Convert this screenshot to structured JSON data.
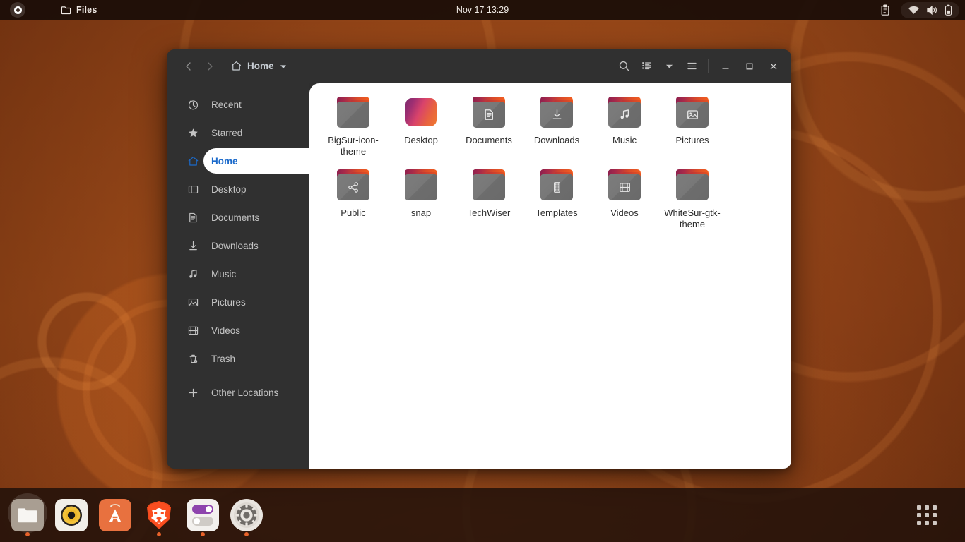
{
  "topbar": {
    "activities_icon": "activities-circle-icon",
    "app_menu": {
      "icon": "folder-icon",
      "label": "Files"
    },
    "clock": "Nov 17  13:29",
    "indicators": [
      {
        "name": "clipboard-icon"
      },
      {
        "name": "wifi-icon"
      },
      {
        "name": "volume-icon"
      },
      {
        "name": "battery-icon"
      }
    ]
  },
  "window": {
    "title": "Files",
    "header": {
      "back_icon": "chevron-left-icon",
      "forward_icon": "chevron-right-icon",
      "path_icon": "home-icon",
      "path_label": "Home",
      "path_dropdown_icon": "chevron-down-icon",
      "search_icon": "search-icon",
      "view_list_icon": "view-list-icon",
      "view_dropdown_icon": "chevron-down-icon",
      "menu_icon": "hamburger-menu-icon",
      "minimize_icon": "minimize-icon",
      "maximize_icon": "maximize-icon",
      "close_icon": "close-icon"
    },
    "sidebar": {
      "items": [
        {
          "label": "Recent",
          "icon": "clock-icon",
          "selected": false
        },
        {
          "label": "Starred",
          "icon": "star-icon",
          "selected": false
        },
        {
          "label": "Home",
          "icon": "home-icon",
          "selected": true
        },
        {
          "label": "Desktop",
          "icon": "desktop-icon",
          "selected": false
        },
        {
          "label": "Documents",
          "icon": "document-icon",
          "selected": false
        },
        {
          "label": "Downloads",
          "icon": "download-icon",
          "selected": false
        },
        {
          "label": "Music",
          "icon": "music-note-icon",
          "selected": false
        },
        {
          "label": "Pictures",
          "icon": "image-icon",
          "selected": false
        },
        {
          "label": "Videos",
          "icon": "film-icon",
          "selected": false
        },
        {
          "label": "Trash",
          "icon": "trash-icon",
          "selected": false
        },
        {
          "label": "Other Locations",
          "icon": "plus-icon",
          "selected": false
        }
      ]
    },
    "files": [
      {
        "name": "BigSur-icon-theme",
        "kind": "folder",
        "emblem": "none"
      },
      {
        "name": "Desktop",
        "kind": "app-folder",
        "emblem": "none"
      },
      {
        "name": "Documents",
        "kind": "folder",
        "emblem": "document-icon"
      },
      {
        "name": "Downloads",
        "kind": "folder",
        "emblem": "download-icon"
      },
      {
        "name": "Music",
        "kind": "folder",
        "emblem": "music-note-icon"
      },
      {
        "name": "Pictures",
        "kind": "folder",
        "emblem": "image-icon"
      },
      {
        "name": "Public",
        "kind": "folder",
        "emblem": "share-icon"
      },
      {
        "name": "snap",
        "kind": "folder",
        "emblem": "none"
      },
      {
        "name": "TechWiser",
        "kind": "folder",
        "emblem": "none"
      },
      {
        "name": "Templates",
        "kind": "folder",
        "emblem": "template-icon"
      },
      {
        "name": "Videos",
        "kind": "folder",
        "emblem": "film-icon"
      },
      {
        "name": "WhiteSur-gtk-theme",
        "kind": "folder",
        "emblem": "none"
      }
    ]
  },
  "dock": {
    "apps": [
      {
        "name": "files",
        "icon": "files-icon",
        "running": true
      },
      {
        "name": "rhythmbox",
        "icon": "rhythmbox-icon",
        "running": false
      },
      {
        "name": "ubuntu-software",
        "icon": "ubuntu-software-icon",
        "running": false
      },
      {
        "name": "brave-browser",
        "icon": "brave-lion-icon",
        "running": true
      },
      {
        "name": "gnome-tweaks",
        "icon": "toggles-icon",
        "running": true
      },
      {
        "name": "settings",
        "icon": "gear-icon",
        "running": true
      }
    ],
    "show_apps": {
      "icon": "app-grid-icon"
    }
  },
  "colors": {
    "accent_blue": "#1b6acb",
    "accent_orange": "#e8622a",
    "desktop_brown": "#97461a",
    "window_chrome": "#303030",
    "content_bg": "#ffffff"
  }
}
